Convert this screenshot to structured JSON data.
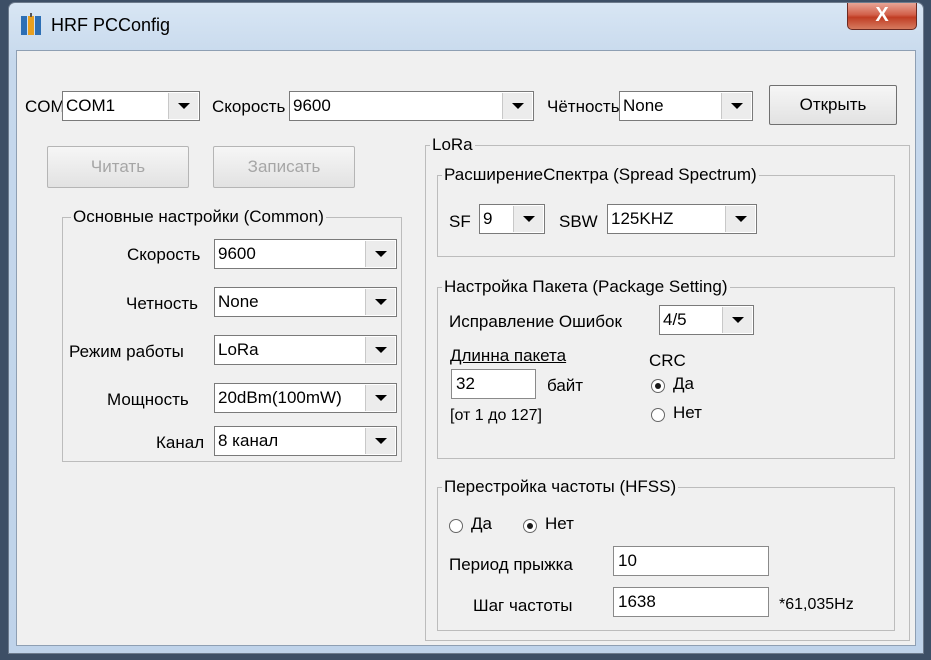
{
  "window": {
    "title": "HRF PCConfig",
    "close_glyph": "X",
    "icon": "app-icon"
  },
  "top": {
    "com_label": "COM",
    "com_value": "COM1",
    "speed_label": "Скорость",
    "speed_value": "9600",
    "parity_label": "Чётность",
    "parity_value": "None",
    "open_label": "Открыть"
  },
  "actions": {
    "read_label": "Читать",
    "write_label": "Записать"
  },
  "common": {
    "title": "Основные настройки (Common)",
    "speed_label": "Скорость",
    "speed_value": "9600",
    "parity_label": "Четность",
    "parity_value": "None",
    "mode_label": "Режим работы",
    "mode_value": "LoRa",
    "power_label": "Мощность",
    "power_value": "20dBm(100mW)",
    "channel_label": "Канал",
    "channel_value": "8 канал"
  },
  "lora": {
    "title": "LoRa",
    "spread": {
      "title": "РасширениеСпектра (Spread Spectrum)",
      "sf_label": "SF",
      "sf_value": "9",
      "sbw_label": "SBW",
      "sbw_value": "125KHZ"
    },
    "package": {
      "title": "Настройка Пакета (Package Setting)",
      "fec_label": "Исправление Ошибок",
      "fec_value": "4/5",
      "length_label": "Длинна пакета",
      "length_value": "32",
      "length_unit": "байт",
      "length_range": "[от 1 до 127]",
      "crc_label": "CRC",
      "crc_yes": "Да",
      "crc_no": "Нет",
      "crc_selected": "yes"
    },
    "hfss": {
      "title": "Перестройка частоты (HFSS)",
      "yes": "Да",
      "no": "Нет",
      "selected": "no",
      "hop_period_label": "Период прыжка",
      "hop_period_value": "10",
      "step_label": "Шаг частоты",
      "step_value": "1638",
      "step_unit": "*61,035Hz"
    }
  }
}
